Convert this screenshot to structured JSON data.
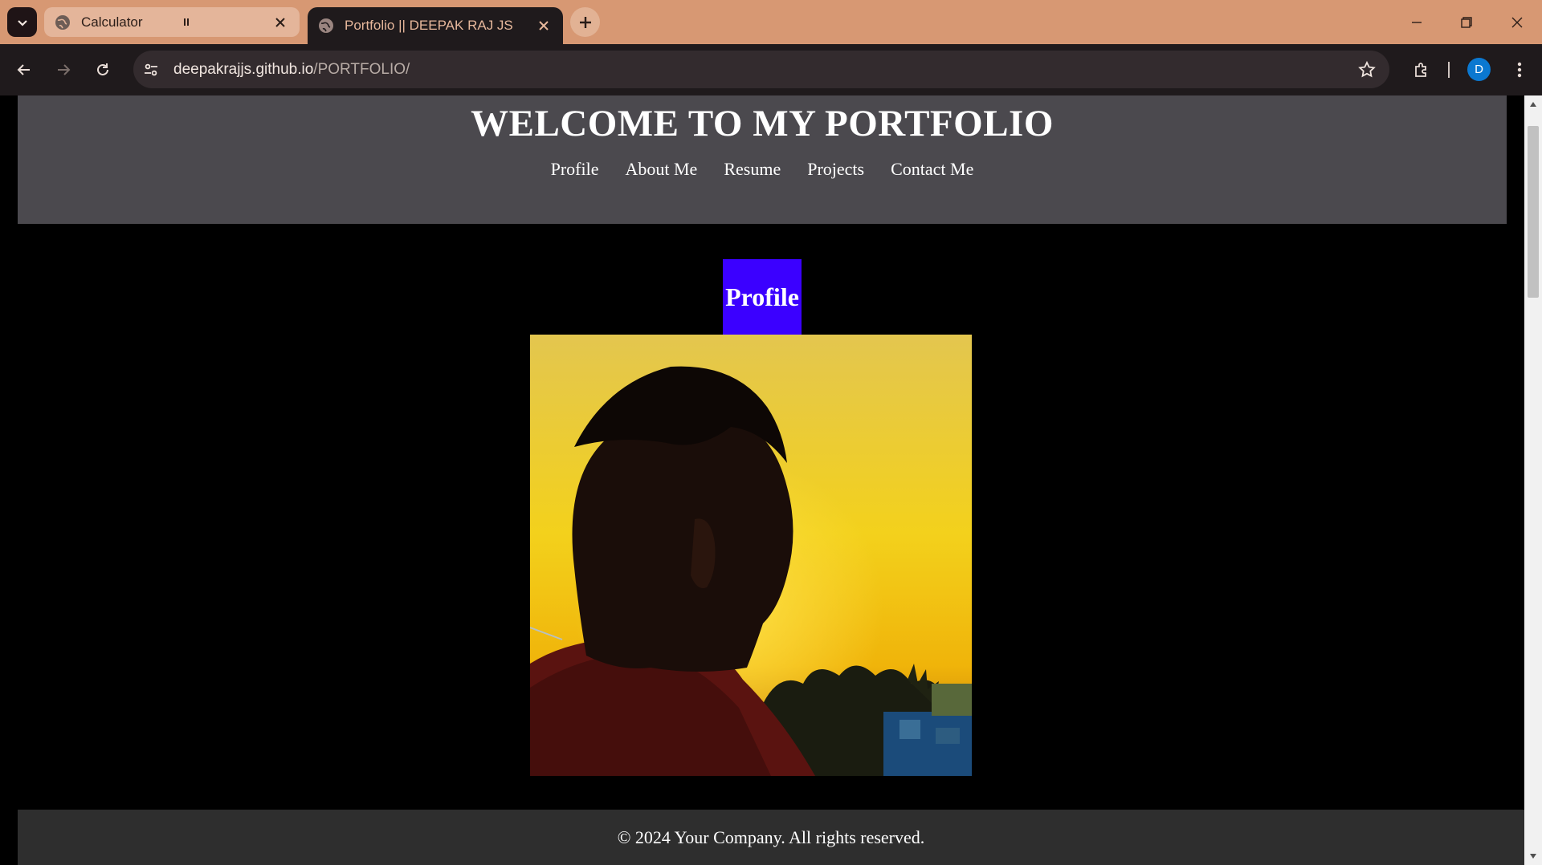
{
  "browser": {
    "tabs": [
      {
        "title": "Calculator",
        "suffix_icon": "pause-indicator-icon",
        "active": false
      },
      {
        "title": "Portfolio || DEEPAK RAJ JS",
        "active": true
      }
    ],
    "url_host": "deepakrajjs.github.io",
    "url_path": "/PORTFOLIO/",
    "profile_initial": "D",
    "colors": {
      "frame": "#d79873",
      "toolbar": "#1f1a1c",
      "avatar": "#0b78d0"
    }
  },
  "page": {
    "header_title": "WELCOME TO MY PORTFOLIO",
    "nav": [
      "Profile",
      "About Me",
      "Resume",
      "Projects",
      "Contact Me"
    ],
    "section_heading": "Profile",
    "photo_alt": "profile-photo",
    "footer_text": "© 2024 Your Company. All rights reserved.",
    "colors": {
      "header_bg": "#4b494e",
      "section_heading_bg": "#3b00ff",
      "footer_bg": "#2e2e2e"
    }
  }
}
